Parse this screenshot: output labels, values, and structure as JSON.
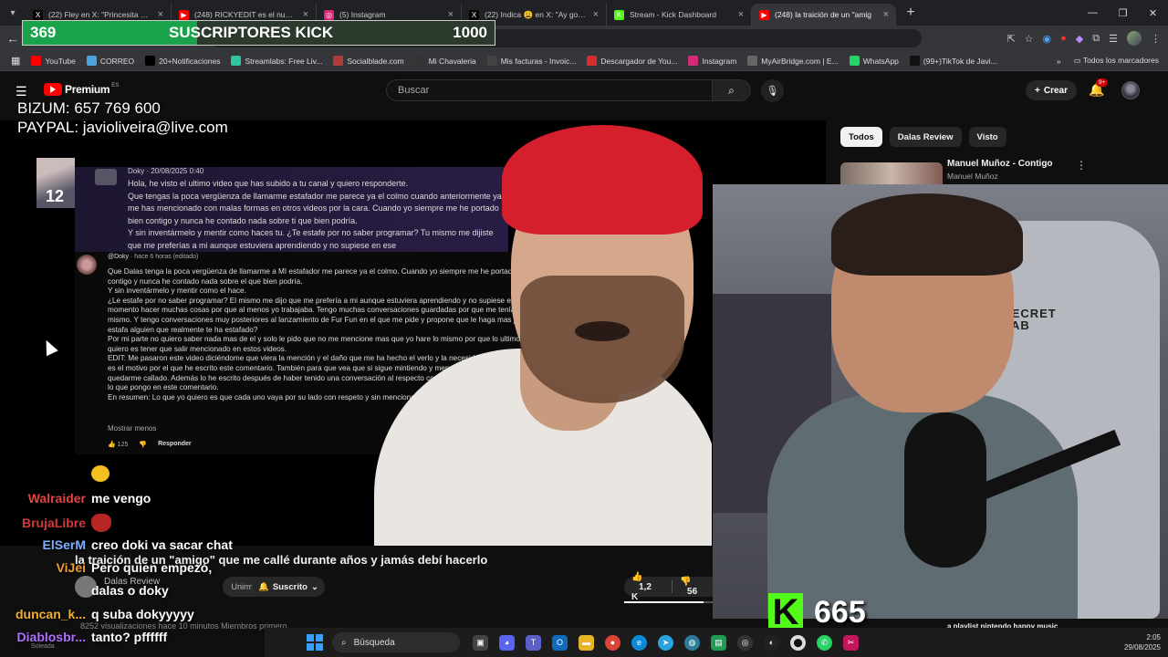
{
  "browser": {
    "tabs": [
      {
        "title": "(22) Fley en X: \"Princesita habla",
        "icon_color": "#000000",
        "icon_text": "X"
      },
      {
        "title": "(248) RICKYEDIT es el nuevo D",
        "icon_color": "#ff0000",
        "icon_text": "▶"
      },
      {
        "title": "(5) Instagram",
        "icon_color": "#d62976",
        "icon_text": "◎"
      },
      {
        "title": "(22) Indica 😩 en X: \"Ay gonon",
        "icon_color": "#000000",
        "icon_text": "X"
      },
      {
        "title": "Stream - Kick Dashboard",
        "icon_color": "#53fc18",
        "icon_text": "K"
      },
      {
        "title": "(248) la traición de un \"amig",
        "icon_color": "#ff0000",
        "icon_text": "▶"
      }
    ],
    "active_tab_index": 5,
    "url_fragment": "v=wsTKmSVQNA0&t=1528s&ab_channel=DalasReview",
    "bookmarks": [
      {
        "label": "YouTube",
        "color": "#ff0000"
      },
      {
        "label": "CORREO",
        "color": "#4aa3df"
      },
      {
        "label": "20+Notificaciones",
        "color": "#000000"
      },
      {
        "label": "Streamlabs: Free Liv...",
        "color": "#31c3a2"
      },
      {
        "label": "Socialblade.com",
        "color": "#b23a3a"
      },
      {
        "label": "Mi Chavaleria",
        "color": "#333333"
      },
      {
        "label": "Mis facturas - Invoic...",
        "color": "#444444"
      },
      {
        "label": "Descargador de You...",
        "color": "#d82d2d"
      },
      {
        "label": "Instagram",
        "color": "#d62976"
      },
      {
        "label": "MyAirBridge.com | E...",
        "color": "#666666"
      },
      {
        "label": "WhatsApp",
        "color": "#25d366"
      },
      {
        "label": "(99+)TikTok de Javi...",
        "color": "#111111"
      }
    ],
    "all_bookmarks": "Todos los marcadores"
  },
  "overlay": {
    "subs_current": "369",
    "subs_label": "SUSCRIPTORES KICK",
    "subs_goal": "1000",
    "subs_progress": 0.369,
    "donate_line1": "BIZUM: 657 769 600",
    "donate_line2": "PAYPAL: javioliveira@live.com",
    "kick_viewers": "665",
    "kick_color": "#53fc18"
  },
  "youtube": {
    "logo_text": "Premium",
    "logo_sup": "ES",
    "search_placeholder": "Buscar",
    "create_label": "Crear",
    "notif_badge": "9+",
    "video_title": "la traición de un \"amigo\" que me callé durante años y jamás debí hacerlo",
    "channel_name": "Dalas Review",
    "join_label": "Unirme",
    "subscribed_label": "Suscrito",
    "likes": "1,2 K",
    "dislike_count": "56",
    "views_line": "8252 visualizaciones hace 10 minutos  Miembros primero",
    "chips": [
      "Todos",
      "Dalas Review",
      "Visto"
    ],
    "rec1_title": "Manuel Muñoz - Contigo",
    "rec1_channel": "Manuel Muñoz",
    "rec2_title": "a playlist nintendo happy music"
  },
  "comment_img": {
    "name": "Doky · 20/08/2025 0:40",
    "text": "Hola, he visto el ultimo video que has subido a tu canal y quiero responderte.\nQue tengas la poca vergüenza de llamarme estafador me parece ya el colmo cuando anteriormente ya me has mencionado con malas formas en otros videos por la cara. Cuando yo siempre me he portado bien contigo y nunca he contado nada sobre ti que bien podría.\nY sin inventármelo y mentir como haces tu.  ¿Te estafe por no saber programar? Tu mismo me dijiste que me preferías a mi aunque estuviera aprendiendo  y no supiese en ese"
  },
  "comment2": {
    "author": "@Doky",
    "meta": "· hace 6 horas (editado)",
    "body": "Que Dalas tenga la poca vergüenza de llamarme a MI estafador me parece ya el colmo. Cuando yo siempre me he portado bien contigo y nunca he contado nada sobre el que bien podría.\nY sin inventármelo y mentir como el hace.\n¿Le estafe por no saber programar? El mismo me dijo que me prefería a mi aunque estuviera aprendiendo  y no supiese en ese momento hacer muchas cosas por que al menos yo trabajaba. Tengo muchas conversaciones guardadas por que me tenía esto mismo. Y tengo conversaciones muy posteriores al lanzamiento de Fur Fun en el que me pide y propone que le haga mas juegos. ¿Se estafa alguien que realmente te ha estafado?\nPor mi parte no quiero saber nada mas de el y solo le pido que no me mencione mas que yo hare lo mismo por que lo ultimo que quiero es tener que salir mencionado en estos videos.\nEDIT: Me pasaron este video diciéndome que viera la mención y el daño que me ha hecho el verlo y la necesidad de aclarar el asunto es el motivo por el que he escrito este comentario. También para que vea que si sigue mintiendo y mencionándome no voy a quedarme callado. Además lo he escrito después de haber tenido una conversación al respecto con Dalas antes en privado diciéndole lo que pongo en este comentario.\nEn resumen: Lo que yo quiero es que cada uno vaya por su lado con respeto y sin mencionarnos mas.",
    "show_less": "Mostrar menos",
    "likes": "125",
    "reply": "Responder"
  },
  "left_thumb_text": "12",
  "streamcam_brand": "SECRET\nLAB",
  "chat": [
    {
      "user": "",
      "msg": "",
      "emote": "smile",
      "color": "#ffffff"
    },
    {
      "user": "Walraider",
      "msg": "me vengo",
      "emote": "",
      "color": "#e0443f"
    },
    {
      "user": "BrujaLibre",
      "msg": "",
      "emote": "demon",
      "color": "#d03a3a"
    },
    {
      "user": "ElSerM",
      "msg": "creo doki va sacar chat",
      "emote": "",
      "color": "#7fb0ff"
    },
    {
      "user": "ViJei",
      "msg": "Pero quien empezó,",
      "emote": "",
      "color": "#f0a030"
    },
    {
      "user": "",
      "msg": "dalas o doky",
      "emote": "",
      "color": "#ffffff"
    },
    {
      "user": "duncan_k...",
      "msg": "q suba dokyyyyy",
      "emote": "",
      "color": "#f0b030"
    },
    {
      "user": "Diablosbr...",
      "msg": "tanto? pffffff",
      "emote": "",
      "color": "#b070ff"
    }
  ],
  "chat_footer": "Soleada",
  "taskbar": {
    "search_label": "Búsqueda",
    "time": "2:05",
    "date": "29/08/2025"
  }
}
